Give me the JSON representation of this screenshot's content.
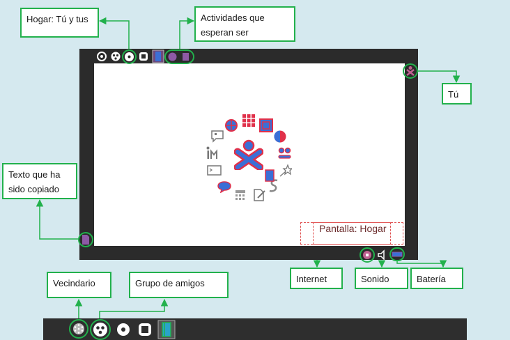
{
  "callouts": {
    "hogar": "Hogar: Tú y tus",
    "actividades": "Actividades que esperan ser",
    "tu": "Tú",
    "texto": "Texto que ha sido copiado",
    "internet": "Internet",
    "sonido": "Sonido",
    "bateria": "Batería",
    "vecindario": "Vecindario",
    "grupo": "Grupo de amigos"
  },
  "screen_label": "Pantalla: Hogar",
  "colors": {
    "accent_green": "#22b14c",
    "frame": "#2b2b2b",
    "xo_stroke": "#e0304a",
    "xo_fill": "#3b6fd6",
    "background": "#d5e9ef"
  },
  "icons": {
    "top_toolbar": [
      "neighborhood-icon",
      "friends-icon",
      "home-icon",
      "activity-view-icon",
      "journal-icon",
      "activity-circle-icon",
      "activity-square-icon"
    ],
    "ring": [
      "browse-icon",
      "memorize-icon",
      "calculate-grid-icon",
      "pippy-icon",
      "chat-icon",
      "terminal-icon",
      "read-icon",
      "turtle-icon",
      "paint-icon",
      "write-icon",
      "speak-icon",
      "record-icon",
      "star-icon",
      "journal-icon"
    ],
    "bottom_toolbar": [
      "neighborhood-icon",
      "friends-icon",
      "home-icon",
      "activity-view-icon",
      "journal-icon"
    ]
  }
}
